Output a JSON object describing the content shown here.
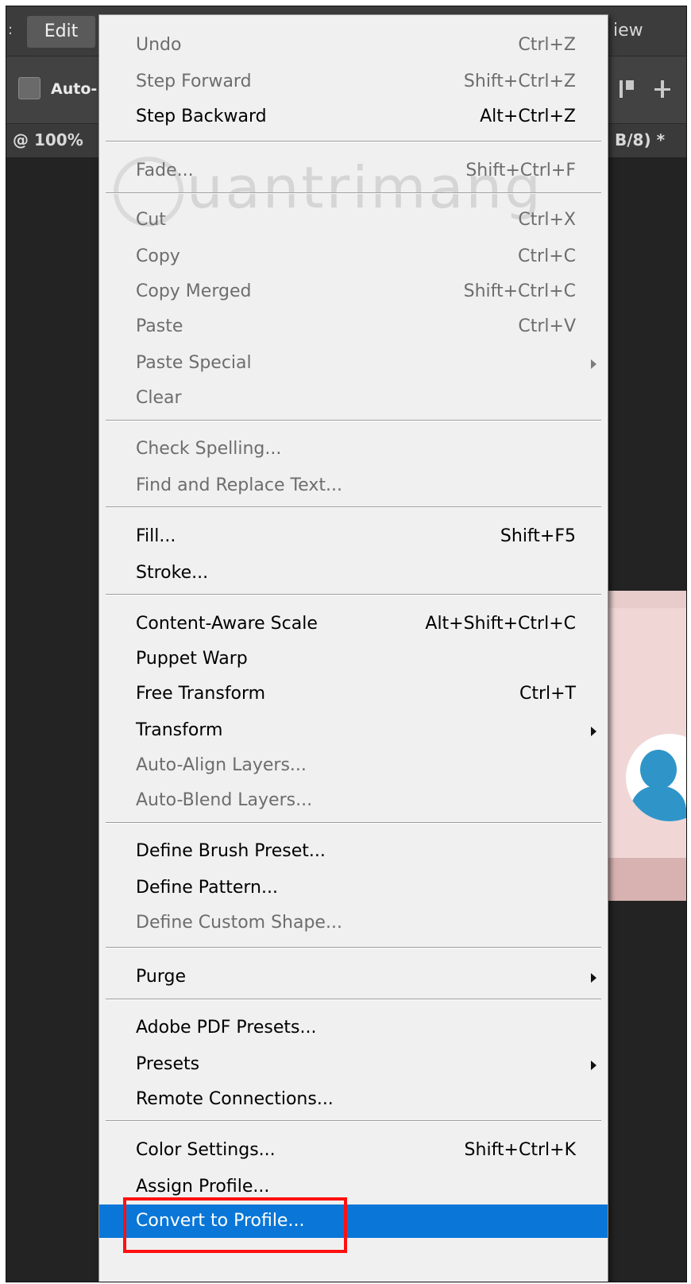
{
  "menubar": {
    "active_menu": "Edit",
    "next_menu_partial": "iew"
  },
  "options_bar": {
    "auto_select_label": "Auto-"
  },
  "document_tab": {
    "zoom_partial": "@ 100%",
    "mode_partial": "B/8) *"
  },
  "watermark": "uantrimang",
  "colors": {
    "menu_background": "#f0f0f0",
    "highlight": "#0a77d8",
    "annotation_box": "#ff1010",
    "workspace": "#232323"
  },
  "edit_menu": {
    "items": [
      {
        "label": "Undo",
        "shortcut": "Ctrl+Z",
        "enabled": false,
        "submenu": false
      },
      {
        "label": "Step Forward",
        "shortcut": "Shift+Ctrl+Z",
        "enabled": false,
        "submenu": false
      },
      {
        "label": "Step Backward",
        "shortcut": "Alt+Ctrl+Z",
        "enabled": true,
        "submenu": false
      },
      {
        "label": "Fade...",
        "shortcut": "Shift+Ctrl+F",
        "enabled": false,
        "submenu": false
      },
      {
        "label": "Cut",
        "shortcut": "Ctrl+X",
        "enabled": false,
        "submenu": false
      },
      {
        "label": "Copy",
        "shortcut": "Ctrl+C",
        "enabled": false,
        "submenu": false
      },
      {
        "label": "Copy Merged",
        "shortcut": "Shift+Ctrl+C",
        "enabled": false,
        "submenu": false
      },
      {
        "label": "Paste",
        "shortcut": "Ctrl+V",
        "enabled": false,
        "submenu": false
      },
      {
        "label": "Paste Special",
        "shortcut": "",
        "enabled": false,
        "submenu": true
      },
      {
        "label": "Clear",
        "shortcut": "",
        "enabled": false,
        "submenu": false
      },
      {
        "label": "Check Spelling...",
        "shortcut": "",
        "enabled": false,
        "submenu": false
      },
      {
        "label": "Find and Replace Text...",
        "shortcut": "",
        "enabled": false,
        "submenu": false
      },
      {
        "label": "Fill...",
        "shortcut": "Shift+F5",
        "enabled": true,
        "submenu": false
      },
      {
        "label": "Stroke...",
        "shortcut": "",
        "enabled": true,
        "submenu": false
      },
      {
        "label": "Content-Aware Scale",
        "shortcut": "Alt+Shift+Ctrl+C",
        "enabled": true,
        "submenu": false
      },
      {
        "label": "Puppet Warp",
        "shortcut": "",
        "enabled": true,
        "submenu": false
      },
      {
        "label": "Free Transform",
        "shortcut": "Ctrl+T",
        "enabled": true,
        "submenu": false
      },
      {
        "label": "Transform",
        "shortcut": "",
        "enabled": true,
        "submenu": true
      },
      {
        "label": "Auto-Align Layers...",
        "shortcut": "",
        "enabled": false,
        "submenu": false
      },
      {
        "label": "Auto-Blend Layers...",
        "shortcut": "",
        "enabled": false,
        "submenu": false
      },
      {
        "label": "Define Brush Preset...",
        "shortcut": "",
        "enabled": true,
        "submenu": false
      },
      {
        "label": "Define Pattern...",
        "shortcut": "",
        "enabled": true,
        "submenu": false
      },
      {
        "label": "Define Custom Shape...",
        "shortcut": "",
        "enabled": false,
        "submenu": false
      },
      {
        "label": "Purge",
        "shortcut": "",
        "enabled": true,
        "submenu": true
      },
      {
        "label": "Adobe PDF Presets...",
        "shortcut": "",
        "enabled": true,
        "submenu": false
      },
      {
        "label": "Presets",
        "shortcut": "",
        "enabled": true,
        "submenu": true
      },
      {
        "label": "Remote Connections...",
        "shortcut": "",
        "enabled": true,
        "submenu": false
      },
      {
        "label": "Color Settings...",
        "shortcut": "Shift+Ctrl+K",
        "enabled": true,
        "submenu": false
      },
      {
        "label": "Assign Profile...",
        "shortcut": "",
        "enabled": true,
        "submenu": false
      },
      {
        "label": "Convert to Profile...",
        "shortcut": "",
        "enabled": true,
        "submenu": false,
        "highlighted": true
      }
    ]
  }
}
